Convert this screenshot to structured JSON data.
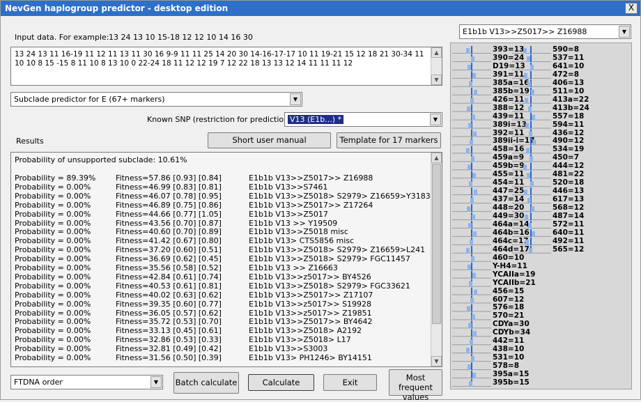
{
  "window": {
    "title": "NevGen haplogroup predictor - desktop edition",
    "close": "X"
  },
  "input": {
    "label": "Input data. For example:",
    "example": "13 24 13 10 15-18 12 12 10 14 16 30",
    "value": "13 24 13 11 16-19 11 12 11 13 11 30 16 9-9 11 11 25 14 20 30 14-16-17-17 10 11 19-21 15 12 18 21 30-34 11 10 10 8 15 -15 8 11 10 8 13 10 0 22-24 18 11 12 12 19 7 12 22 18 13 13 12 14 11 11 11 12"
  },
  "top_right_select": "E1b1b V13>>Z5017>> Z16988",
  "predictor_select": "Subclade predictor for E (67+ markers)",
  "snp": {
    "label": "Known SNP (restriction for prediction):",
    "value": "V13 (E1b...) *"
  },
  "results_label": "Results",
  "buttons": {
    "manual": "Short user manual",
    "template": "Template for 17 markers",
    "batch": "Batch calculate",
    "calculate": "Calculate",
    "exit": "Exit",
    "most_frequent": "Most frequent values"
  },
  "order_select": "FTDNA order",
  "unsupported": "Probability of unsupported subclade: 10.61%",
  "results": [
    {
      "p": "Probability = 89.39%",
      "f": "Fitness=57.86 [0.93] [0.84]",
      "s": "E1b1b V13>>Z5017>> Z16988"
    },
    {
      "p": "Probability = 0.00%",
      "f": "Fitness=46.99 [0.83] [0.81]",
      "s": "E1b1b V13>>S7461"
    },
    {
      "p": "Probability = 0.00%",
      "f": "Fitness=46.07 [0.78] [0.95]",
      "s": "E1b1b V13>>Z5018> S2979> Z16659>Y3183"
    },
    {
      "p": "Probability = 0.00%",
      "f": "Fitness=46.89 [0.75] [0.86]",
      "s": "E1b1b V13>>Z5017>> Z17264"
    },
    {
      "p": "Probability = 0.00%",
      "f": "Fitness=44.66 [0.77] [1.05]",
      "s": "E1b1b V13>>Z5017"
    },
    {
      "p": "Probability = 0.00%",
      "f": "Fitness=43.56 [0.70] [0.87]",
      "s": "E1b1b V13 >> Y19509"
    },
    {
      "p": "Probability = 0.00%",
      "f": "Fitness=40.60 [0.70] [0.89]",
      "s": "E1b1b V13>>Z5018 misc"
    },
    {
      "p": "Probability = 0.00%",
      "f": "Fitness=41.42 [0.67] [0.80]",
      "s": "E1b1b V13> CTS5856 misc"
    },
    {
      "p": "Probability = 0.00%",
      "f": "Fitness=37.20 [0.60] [0.51]",
      "s": "E1b1b V13>>Z5018> S2979> Z16659>L241"
    },
    {
      "p": "Probability = 0.00%",
      "f": "Fitness=36.69 [0.62] [0.45]",
      "s": "E1b1b V13>>Z5018> S2979> FGC11457"
    },
    {
      "p": "Probability = 0.00%",
      "f": "Fitness=35.56 [0.58] [0.52]",
      "s": "E1b1b V13 >> Z16663"
    },
    {
      "p": "Probability = 0.00%",
      "f": "Fitness=42.84 [0.61] [0.74]",
      "s": "E1b1b V13>>z5017>> BY4526"
    },
    {
      "p": "Probability = 0.00%",
      "f": "Fitness=40.53 [0.61] [0.81]",
      "s": "E1b1b V13>>Z5018> S2979> FGC33621"
    },
    {
      "p": "Probability = 0.00%",
      "f": "Fitness=40.02 [0.63] [0.62]",
      "s": "E1b1b V13>>Z5017>> Z17107"
    },
    {
      "p": "Probability = 0.00%",
      "f": "Fitness=39.35 [0.60] [0.77]",
      "s": "E1b1b V13>>z5017>> S19928"
    },
    {
      "p": "Probability = 0.00%",
      "f": "Fitness=36.05 [0.57] [0.62]",
      "s": "E1b1b V13>>z5017>> Z19851"
    },
    {
      "p": "Probability = 0.00%",
      "f": "Fitness=35.72 [0.53] [0.70]",
      "s": "E1b1b V13>>Z5017>> BY4642"
    },
    {
      "p": "Probability = 0.00%",
      "f": "Fitness=33.13 [0.45] [0.61]",
      "s": "E1b1b V13>>Z5018> A2192"
    },
    {
      "p": "Probability = 0.00%",
      "f": "Fitness=32.86 [0.53] [0.33]",
      "s": "E1b1b V13>>Z5018> L17"
    },
    {
      "p": "Probability = 0.00%",
      "f": "Fitness=32.81 [0.49] [0.42]",
      "s": "E1b1b V13>>S3003"
    },
    {
      "p": "Probability = 0.00%",
      "f": "Fitness=31.56 [0.50] [0.39]",
      "s": "E1b1b V13> PH1246> BY14151"
    }
  ],
  "markers_left": [
    "393=13",
    "390=24",
    "D19=13",
    "391=11",
    "385a=16",
    "385b=19",
    "426=11",
    "388=12",
    "439=11",
    "389i=13",
    "392=11",
    "389ii-i=17",
    "458=16",
    "459a=9",
    "459b=9",
    "455=11",
    "454=11",
    "447=25",
    "437=14",
    "448=20",
    "449=30",
    "464a=14",
    "464b=16",
    "464c=17",
    "464d=17",
    "460=10",
    "Y-H4=11",
    "YCAIIa=19",
    "YCAIIb=21",
    "456=15",
    "607=12",
    "576=18",
    "570=21",
    "CDYa=30",
    "CDYb=34",
    "442=11",
    "438=10",
    "531=10",
    "578=8",
    "395a=15",
    "395b=15"
  ],
  "markers_right": [
    "590=8",
    "537=11",
    "641=10",
    "472=8",
    "406=13",
    "511=10",
    "413a=22",
    "413b=24",
    "557=18",
    "594=11",
    "436=12",
    "490=12",
    "534=19",
    "450=7",
    "444=12",
    "481=22",
    "520=18",
    "446=13",
    "617=13",
    "568=12",
    "487=14",
    "572=11",
    "640=11",
    "492=11",
    "565=12"
  ]
}
